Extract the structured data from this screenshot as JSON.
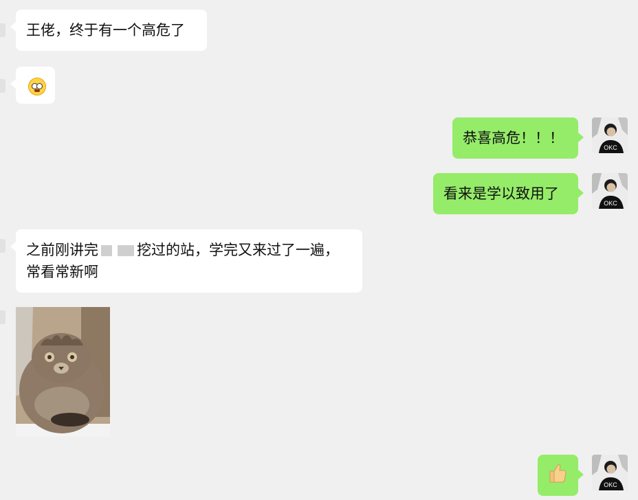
{
  "chat": {
    "messages": [
      {
        "side": "left",
        "text": "王佬，终于有一个高危了"
      },
      {
        "side": "left",
        "emoji": "crying-face-icon"
      },
      {
        "side": "right",
        "text": "恭喜高危！！！"
      },
      {
        "side": "right",
        "text": "看来是学以致用了"
      },
      {
        "side": "left",
        "line1_a": "之前刚讲完",
        "line1_b": "挖过的站，学完又来过了一遍，",
        "line2": "常看常新啊"
      },
      {
        "side": "left",
        "image": "cat-photo"
      },
      {
        "side": "right",
        "emoji": "thumbs-up-icon"
      }
    ]
  },
  "user": {
    "shirt_text": "OKC"
  }
}
